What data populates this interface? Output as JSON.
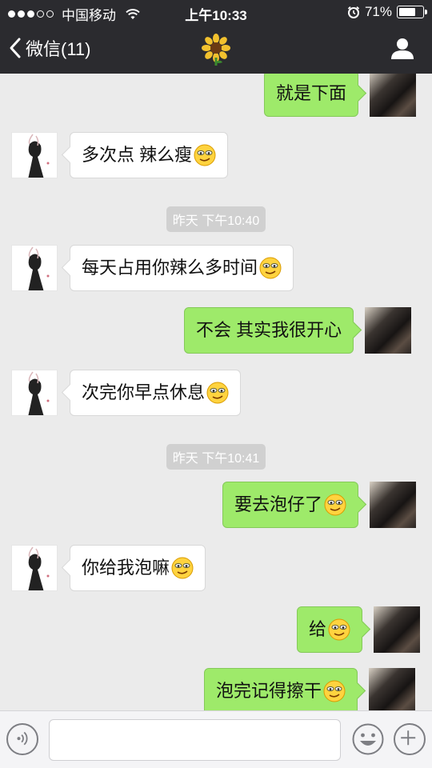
{
  "status_bar": {
    "carrier": "中国移动",
    "time": "上午10:33",
    "battery": "71%",
    "battery_level": 0.71,
    "signal_bars": 3,
    "signal_total": 5
  },
  "nav": {
    "back_label": "微信(11)",
    "title_icon": "sunflower-icon",
    "right_icon": "profile-icon"
  },
  "colors": {
    "nav_bg": "#2b2b2f",
    "chat_bg": "#ebebeb",
    "outgoing_bubble": "#9eea6a",
    "incoming_bubble": "#ffffff"
  },
  "messages": [
    {
      "side": "out",
      "text": "就是下面",
      "emoji": false
    },
    {
      "side": "in",
      "text": "多次点 辣么瘦",
      "emoji": true
    },
    {
      "side": "time",
      "text": "昨天 下午10:40"
    },
    {
      "side": "in",
      "text": "每天占用你辣么多时间",
      "emoji": true
    },
    {
      "side": "out",
      "text": "不会 其实我很开心",
      "emoji": false
    },
    {
      "side": "in",
      "text": "次完你早点休息 ",
      "emoji": true
    },
    {
      "side": "time",
      "text": "昨天 下午10:41"
    },
    {
      "side": "out",
      "text": "要去泡仔了",
      "emoji": true
    },
    {
      "side": "in",
      "text": "你给我泡嘛",
      "emoji": true
    },
    {
      "side": "out",
      "text": "给",
      "emoji": true
    },
    {
      "side": "out",
      "text": "泡完记得擦干",
      "emoji": true
    }
  ],
  "input_bar": {
    "left_icon": "voice-icon",
    "placeholder": "",
    "emoji_icon": "smiley-icon",
    "plus_icon": "plus-icon"
  }
}
